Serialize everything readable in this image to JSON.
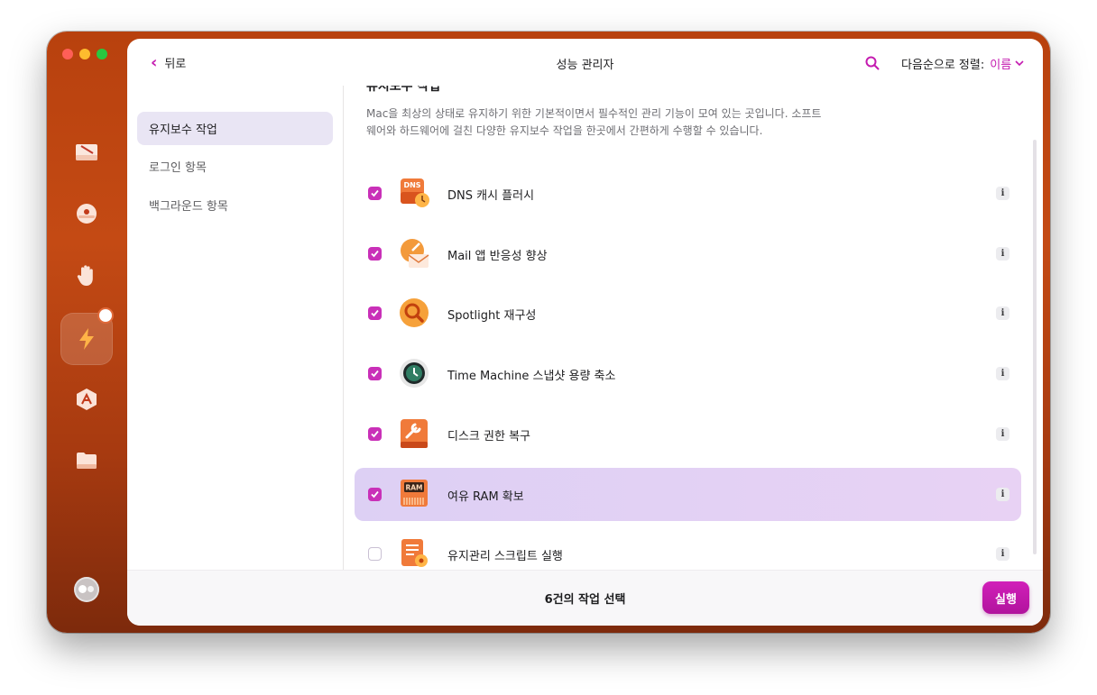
{
  "window": {
    "title": "성능 관리자",
    "back_label": "뒤로",
    "sort": {
      "label": "다음순으로 정렬:",
      "value": "이름"
    }
  },
  "sidebar": {
    "icons": [
      "cleanup-icon",
      "protection-icon",
      "privacy-hand-icon",
      "performance-bolt-icon",
      "applications-icon",
      "files-folder-icon"
    ],
    "active": "performance-bolt-icon"
  },
  "nav": {
    "items": [
      {
        "label": "유지보수 작업",
        "active": true
      },
      {
        "label": "로그인 항목",
        "active": false
      },
      {
        "label": "백그라운드 항목",
        "active": false
      }
    ]
  },
  "content": {
    "section_title": "유지보수 작업",
    "description": "Mac을 최상의 상태로 유지하기 위한 기본적이면서 필수적인 관리 기능이 모여 있는 곳입니다. 소프트웨어와 하드웨어에 걸친 다양한 유지보수 작업을 한곳에서 간편하게 수행할 수 있습니다.",
    "tasks": [
      {
        "label": "DNS 캐시 플러시",
        "checked": true,
        "icon": "dns-icon",
        "selected": false
      },
      {
        "label": "Mail 앱 반응성 향상",
        "checked": true,
        "icon": "mail-speed-icon",
        "selected": false
      },
      {
        "label": "Spotlight 재구성",
        "checked": true,
        "icon": "spotlight-icon",
        "selected": false
      },
      {
        "label": "Time Machine 스냅샷 용량 축소",
        "checked": true,
        "icon": "time-machine-icon",
        "selected": false
      },
      {
        "label": "디스크 권한 복구",
        "checked": true,
        "icon": "disk-repair-icon",
        "selected": false
      },
      {
        "label": "여유 RAM 확보",
        "checked": true,
        "icon": "ram-icon",
        "selected": true
      },
      {
        "label": "유지관리 스크립트 실행",
        "checked": false,
        "icon": "scripts-icon",
        "selected": false
      }
    ],
    "info_glyph": "i",
    "dns_icon_text": "DNS",
    "ram_icon_text": "RAM"
  },
  "footer": {
    "selection_count": "6건의 작업 선택",
    "run_label": "실행"
  },
  "colors": {
    "accent": "#c41bb0",
    "window_gradient_top": "#b8410e",
    "selected_row": "#e2d1f4"
  }
}
